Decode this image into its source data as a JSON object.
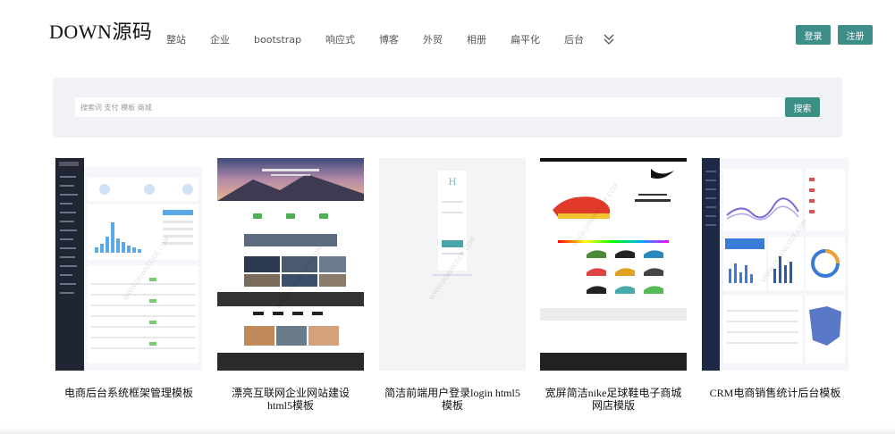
{
  "header": {
    "logo": "DOWN源码",
    "nav": [
      "整站",
      "企业",
      "bootstrap",
      "响应式",
      "博客",
      "外贸",
      "相册",
      "扁平化",
      "后台"
    ],
    "login_label": "登录",
    "register_label": "注册"
  },
  "search": {
    "placeholder": "搜索词 支付 模板 商城",
    "button_label": "搜索"
  },
  "cards": [
    {
      "title": "电商后台系统框架管理模板"
    },
    {
      "title": "漂亮互联网企业网站建设html5模板"
    },
    {
      "title": "简洁前端用户登录login html5模板"
    },
    {
      "title": "宽屏简洁nike足球鞋电子商城网店模版"
    },
    {
      "title": "CRM电商销售统计后台模板"
    }
  ],
  "colors": {
    "accent": "#3d8e86",
    "search_bg": "#f0f2f5"
  }
}
